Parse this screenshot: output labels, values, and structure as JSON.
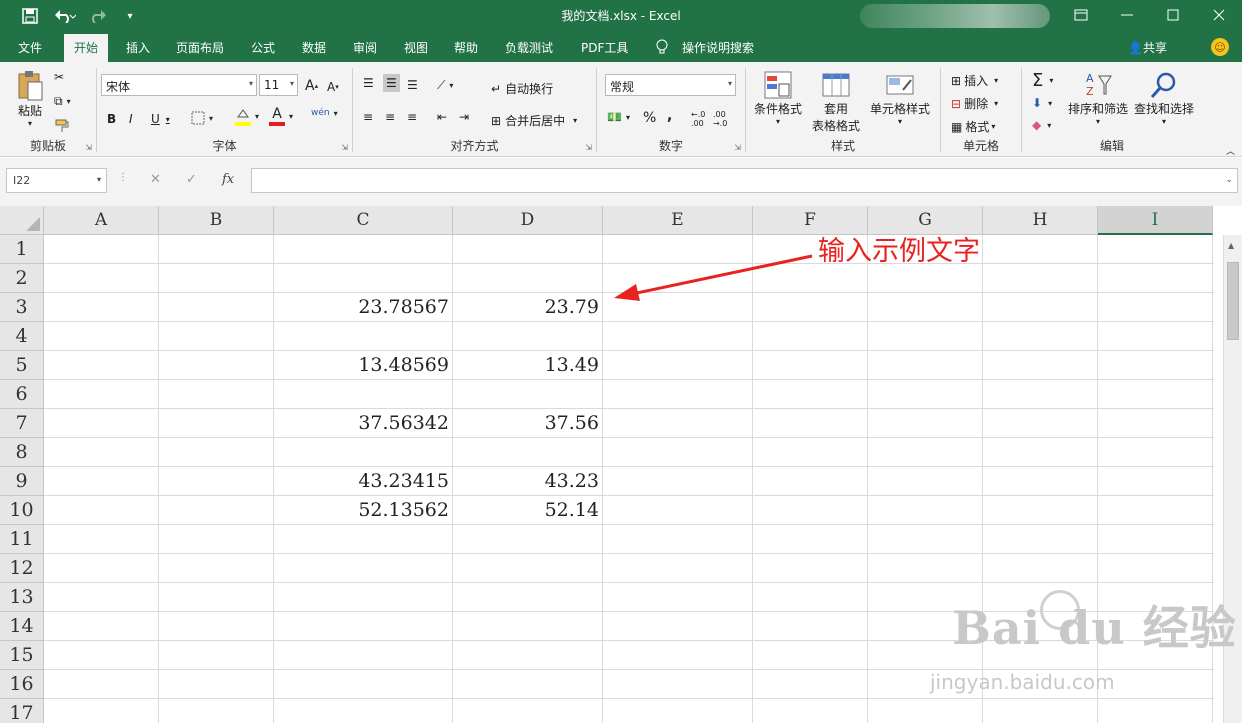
{
  "titlebar": {
    "title": "我的文档.xlsx  -  Excel",
    "icons": [
      "save-icon",
      "undo-icon",
      "redo-icon",
      "customize-qat-icon"
    ]
  },
  "tabs": [
    "文件",
    "开始",
    "插入",
    "页面布局",
    "公式",
    "数据",
    "审阅",
    "视图",
    "帮助",
    "负载测试",
    "PDF工具",
    "操作说明搜索"
  ],
  "active_tab": "开始",
  "share_label": "共享",
  "ribbon": {
    "clipboard": {
      "paste": "粘贴",
      "label": "剪贴板"
    },
    "font": {
      "name": "宋体",
      "size": "11",
      "bold": "B",
      "italic": "I",
      "underline": "U",
      "label": "字体",
      "grow": "A",
      "shrink": "A",
      "fontcolor": "A",
      "phonetic": "wén"
    },
    "align": {
      "wrap": "自动换行",
      "merge": "合并后居中",
      "label": "对齐方式"
    },
    "number": {
      "format": "常规",
      "percent": "%",
      "comma": ",",
      "label": "数字"
    },
    "styles": {
      "cond": "条件格式",
      "table": "套用",
      "table2": "表格格式",
      "cell": "单元格样式",
      "label": "样式"
    },
    "cells": {
      "insert": "插入",
      "delete": "删除",
      "format": "格式",
      "label": "单元格"
    },
    "editing": {
      "sort": "排序和筛选",
      "find": "查找和选择",
      "label": "编辑"
    }
  },
  "formula_bar": {
    "name_box": "I22",
    "fx": "fx",
    "value": ""
  },
  "columns": [
    "A",
    "B",
    "C",
    "D",
    "E",
    "F",
    "G",
    "H",
    "I"
  ],
  "selected_column": "I",
  "rows": [
    "1",
    "2",
    "3",
    "4",
    "5",
    "6",
    "7",
    "8",
    "9",
    "10",
    "11",
    "12",
    "13",
    "14",
    "15",
    "16",
    "17"
  ],
  "cells": {
    "C3": "23.78567",
    "D3": "23.79",
    "C5": "13.48569",
    "D5": "13.49",
    "C7": "37.56342",
    "D7": "37.56",
    "C9": "43.23415",
    "D9": "43.23",
    "C10": "52.13562",
    "D10": "52.14"
  },
  "annotation": {
    "text": "输入示例文字",
    "color": "#e8231f"
  },
  "watermark": {
    "brand": "Bai du 经验",
    "url": "jingyan.baidu.com"
  },
  "colors": {
    "excel_green": "#217346",
    "ribbon_bg": "#f3f3f3",
    "header_bg": "#e6e6e6"
  }
}
